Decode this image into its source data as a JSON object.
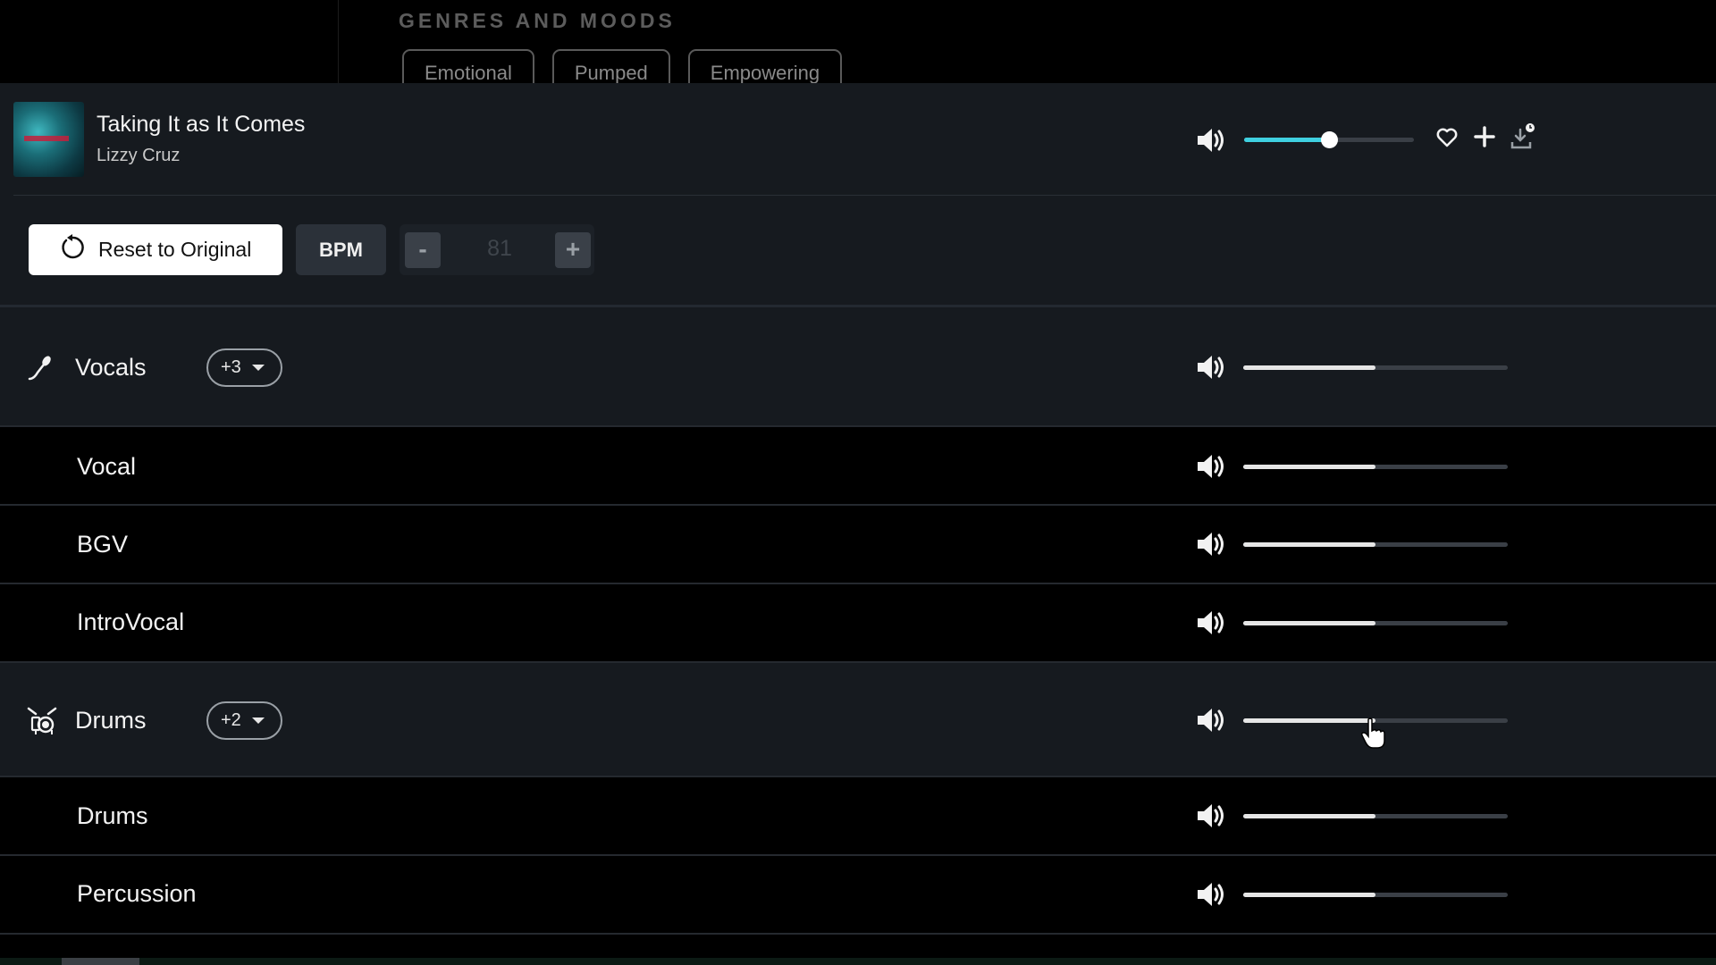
{
  "genres": {
    "heading": "GENRES AND MOODS",
    "chips": [
      "Emotional",
      "Pumped",
      "Empowering"
    ]
  },
  "player": {
    "track_title": "Taking It as It Comes",
    "artist": "Lizzy Cruz",
    "master_volume_percent": 50,
    "accent_color": "#3fd0e0",
    "icons": {
      "volume": "speaker-icon",
      "favorite": "heart-icon",
      "add": "plus-icon",
      "download": "download-icon"
    }
  },
  "controls": {
    "reset_label": "Reset to Original",
    "bpm_label": "BPM",
    "bpm_minus": "-",
    "bpm_plus": "+",
    "bpm_value": "81"
  },
  "stems": {
    "vocals_group": {
      "label": "Vocals",
      "count": "+3",
      "icon": "microphone-icon",
      "volume_percent": 50
    },
    "vocals_items": [
      {
        "label": "Vocal",
        "volume_percent": 50
      },
      {
        "label": "BGV",
        "volume_percent": 50
      },
      {
        "label": "IntroVocal",
        "volume_percent": 50
      }
    ],
    "drums_group": {
      "label": "Drums",
      "count": "+2",
      "icon": "drum-kit-icon",
      "volume_percent": 50
    },
    "drums_items": [
      {
        "label": "Drums",
        "volume_percent": 50
      },
      {
        "label": "Percussion",
        "volume_percent": 50
      }
    ],
    "slider_fill_color": "#e6e6e6",
    "slider_track_color": "#3a3f46"
  }
}
